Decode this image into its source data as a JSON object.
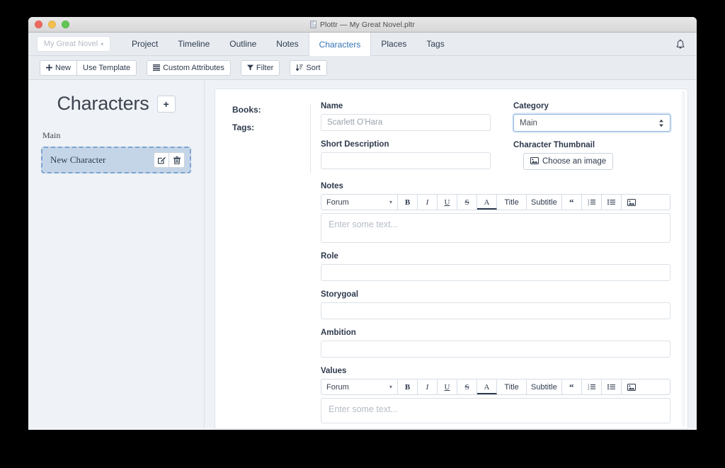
{
  "window": {
    "title": "Plottr — My Great Novel.pltr",
    "doc_icon": "document-icon",
    "traffic_lights": [
      "close",
      "minimize",
      "zoom"
    ]
  },
  "navbar": {
    "project_selector": {
      "label": "My Great Novel",
      "caret": "▾"
    },
    "tabs": [
      {
        "label": "Project",
        "active": false
      },
      {
        "label": "Timeline",
        "active": false
      },
      {
        "label": "Outline",
        "active": false
      },
      {
        "label": "Notes",
        "active": false
      },
      {
        "label": "Characters",
        "active": true
      },
      {
        "label": "Places",
        "active": false
      },
      {
        "label": "Tags",
        "active": false
      }
    ],
    "bell": "bell-icon"
  },
  "toolbar": {
    "new_label": "New",
    "use_template_label": "Use Template",
    "custom_attributes_label": "Custom Attributes",
    "filter_label": "Filter",
    "sort_label": "Sort"
  },
  "sidebar": {
    "title": "Characters",
    "add_label": "+",
    "category_label": "Main",
    "items": [
      {
        "name": "New Character",
        "edit_icon": "edit-icon",
        "delete_icon": "trash-icon"
      }
    ]
  },
  "detail": {
    "meta": {
      "books_label": "Books:",
      "tags_label": "Tags:"
    },
    "name": {
      "label": "Name",
      "value": "",
      "placeholder": "Scarlett O'Hara"
    },
    "short_description": {
      "label": "Short Description",
      "value": "",
      "placeholder": ""
    },
    "category": {
      "label": "Category",
      "selected": "Main",
      "options": [
        "Main"
      ]
    },
    "thumbnail": {
      "label": "Character Thumbnail",
      "button_label": "Choose an image",
      "button_icon": "image-icon"
    },
    "notes": {
      "label": "Notes",
      "placeholder": "Enter some text..."
    },
    "role": {
      "label": "Role",
      "value": ""
    },
    "storygoal": {
      "label": "Storygoal",
      "value": ""
    },
    "ambition": {
      "label": "Ambition",
      "value": ""
    },
    "values": {
      "label": "Values",
      "placeholder": "Enter some text..."
    }
  },
  "rte": {
    "font": "Forum",
    "caret": "▾",
    "buttons": [
      {
        "name": "bold",
        "label": "B"
      },
      {
        "name": "italic",
        "label": "I"
      },
      {
        "name": "underline",
        "label": "U"
      },
      {
        "name": "strikethrough",
        "label": "S"
      },
      {
        "name": "text-color",
        "label": "A"
      },
      {
        "name": "title",
        "label": "Title"
      },
      {
        "name": "subtitle",
        "label": "Subtitle"
      },
      {
        "name": "blockquote",
        "label": "“"
      },
      {
        "name": "ordered-list",
        "label": ""
      },
      {
        "name": "unordered-list",
        "label": ""
      },
      {
        "name": "insert-image",
        "label": ""
      }
    ]
  },
  "colors": {
    "accent": "#3573b5",
    "nav_bg": "#e8ecf1",
    "panel_bg": "#eff2f6",
    "selected_item": "#c5d5e8",
    "focus_border": "#8cb4e0"
  }
}
